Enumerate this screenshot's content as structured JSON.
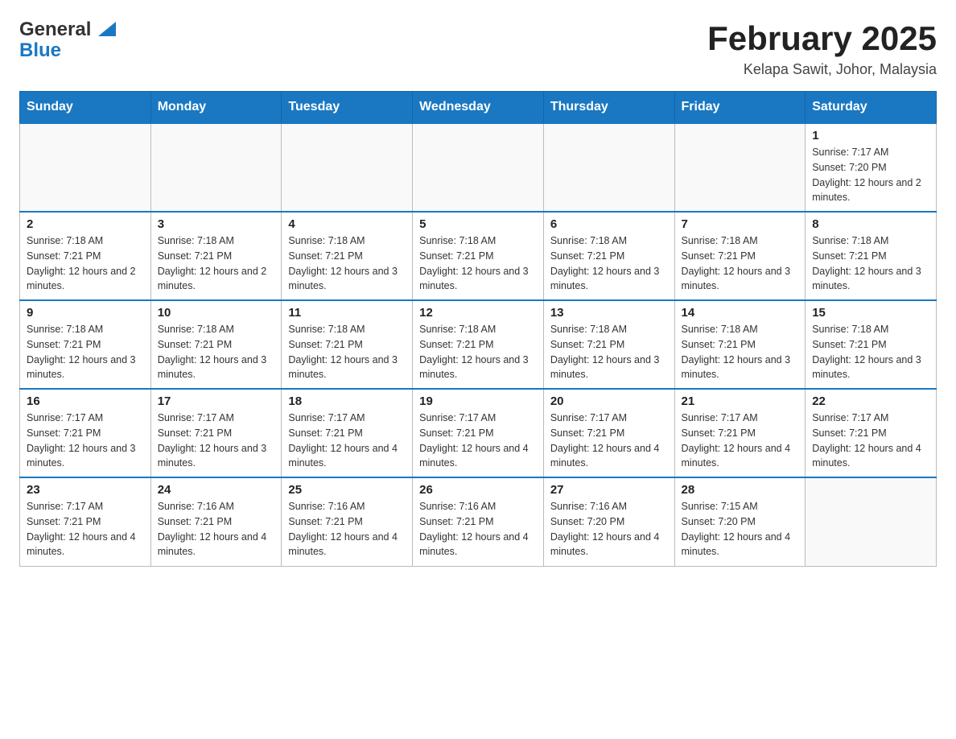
{
  "header": {
    "logo_general": "General",
    "logo_blue": "Blue",
    "calendar_title": "February 2025",
    "calendar_subtitle": "Kelapa Sawit, Johor, Malaysia"
  },
  "weekdays": [
    "Sunday",
    "Monday",
    "Tuesday",
    "Wednesday",
    "Thursday",
    "Friday",
    "Saturday"
  ],
  "weeks": [
    [
      {
        "day": "",
        "sunrise": "",
        "sunset": "",
        "daylight": ""
      },
      {
        "day": "",
        "sunrise": "",
        "sunset": "",
        "daylight": ""
      },
      {
        "day": "",
        "sunrise": "",
        "sunset": "",
        "daylight": ""
      },
      {
        "day": "",
        "sunrise": "",
        "sunset": "",
        "daylight": ""
      },
      {
        "day": "",
        "sunrise": "",
        "sunset": "",
        "daylight": ""
      },
      {
        "day": "",
        "sunrise": "",
        "sunset": "",
        "daylight": ""
      },
      {
        "day": "1",
        "sunrise": "Sunrise: 7:17 AM",
        "sunset": "Sunset: 7:20 PM",
        "daylight": "Daylight: 12 hours and 2 minutes."
      }
    ],
    [
      {
        "day": "2",
        "sunrise": "Sunrise: 7:18 AM",
        "sunset": "Sunset: 7:21 PM",
        "daylight": "Daylight: 12 hours and 2 minutes."
      },
      {
        "day": "3",
        "sunrise": "Sunrise: 7:18 AM",
        "sunset": "Sunset: 7:21 PM",
        "daylight": "Daylight: 12 hours and 2 minutes."
      },
      {
        "day": "4",
        "sunrise": "Sunrise: 7:18 AM",
        "sunset": "Sunset: 7:21 PM",
        "daylight": "Daylight: 12 hours and 3 minutes."
      },
      {
        "day": "5",
        "sunrise": "Sunrise: 7:18 AM",
        "sunset": "Sunset: 7:21 PM",
        "daylight": "Daylight: 12 hours and 3 minutes."
      },
      {
        "day": "6",
        "sunrise": "Sunrise: 7:18 AM",
        "sunset": "Sunset: 7:21 PM",
        "daylight": "Daylight: 12 hours and 3 minutes."
      },
      {
        "day": "7",
        "sunrise": "Sunrise: 7:18 AM",
        "sunset": "Sunset: 7:21 PM",
        "daylight": "Daylight: 12 hours and 3 minutes."
      },
      {
        "day": "8",
        "sunrise": "Sunrise: 7:18 AM",
        "sunset": "Sunset: 7:21 PM",
        "daylight": "Daylight: 12 hours and 3 minutes."
      }
    ],
    [
      {
        "day": "9",
        "sunrise": "Sunrise: 7:18 AM",
        "sunset": "Sunset: 7:21 PM",
        "daylight": "Daylight: 12 hours and 3 minutes."
      },
      {
        "day": "10",
        "sunrise": "Sunrise: 7:18 AM",
        "sunset": "Sunset: 7:21 PM",
        "daylight": "Daylight: 12 hours and 3 minutes."
      },
      {
        "day": "11",
        "sunrise": "Sunrise: 7:18 AM",
        "sunset": "Sunset: 7:21 PM",
        "daylight": "Daylight: 12 hours and 3 minutes."
      },
      {
        "day": "12",
        "sunrise": "Sunrise: 7:18 AM",
        "sunset": "Sunset: 7:21 PM",
        "daylight": "Daylight: 12 hours and 3 minutes."
      },
      {
        "day": "13",
        "sunrise": "Sunrise: 7:18 AM",
        "sunset": "Sunset: 7:21 PM",
        "daylight": "Daylight: 12 hours and 3 minutes."
      },
      {
        "day": "14",
        "sunrise": "Sunrise: 7:18 AM",
        "sunset": "Sunset: 7:21 PM",
        "daylight": "Daylight: 12 hours and 3 minutes."
      },
      {
        "day": "15",
        "sunrise": "Sunrise: 7:18 AM",
        "sunset": "Sunset: 7:21 PM",
        "daylight": "Daylight: 12 hours and 3 minutes."
      }
    ],
    [
      {
        "day": "16",
        "sunrise": "Sunrise: 7:17 AM",
        "sunset": "Sunset: 7:21 PM",
        "daylight": "Daylight: 12 hours and 3 minutes."
      },
      {
        "day": "17",
        "sunrise": "Sunrise: 7:17 AM",
        "sunset": "Sunset: 7:21 PM",
        "daylight": "Daylight: 12 hours and 3 minutes."
      },
      {
        "day": "18",
        "sunrise": "Sunrise: 7:17 AM",
        "sunset": "Sunset: 7:21 PM",
        "daylight": "Daylight: 12 hours and 4 minutes."
      },
      {
        "day": "19",
        "sunrise": "Sunrise: 7:17 AM",
        "sunset": "Sunset: 7:21 PM",
        "daylight": "Daylight: 12 hours and 4 minutes."
      },
      {
        "day": "20",
        "sunrise": "Sunrise: 7:17 AM",
        "sunset": "Sunset: 7:21 PM",
        "daylight": "Daylight: 12 hours and 4 minutes."
      },
      {
        "day": "21",
        "sunrise": "Sunrise: 7:17 AM",
        "sunset": "Sunset: 7:21 PM",
        "daylight": "Daylight: 12 hours and 4 minutes."
      },
      {
        "day": "22",
        "sunrise": "Sunrise: 7:17 AM",
        "sunset": "Sunset: 7:21 PM",
        "daylight": "Daylight: 12 hours and 4 minutes."
      }
    ],
    [
      {
        "day": "23",
        "sunrise": "Sunrise: 7:17 AM",
        "sunset": "Sunset: 7:21 PM",
        "daylight": "Daylight: 12 hours and 4 minutes."
      },
      {
        "day": "24",
        "sunrise": "Sunrise: 7:16 AM",
        "sunset": "Sunset: 7:21 PM",
        "daylight": "Daylight: 12 hours and 4 minutes."
      },
      {
        "day": "25",
        "sunrise": "Sunrise: 7:16 AM",
        "sunset": "Sunset: 7:21 PM",
        "daylight": "Daylight: 12 hours and 4 minutes."
      },
      {
        "day": "26",
        "sunrise": "Sunrise: 7:16 AM",
        "sunset": "Sunset: 7:21 PM",
        "daylight": "Daylight: 12 hours and 4 minutes."
      },
      {
        "day": "27",
        "sunrise": "Sunrise: 7:16 AM",
        "sunset": "Sunset: 7:20 PM",
        "daylight": "Daylight: 12 hours and 4 minutes."
      },
      {
        "day": "28",
        "sunrise": "Sunrise: 7:15 AM",
        "sunset": "Sunset: 7:20 PM",
        "daylight": "Daylight: 12 hours and 4 minutes."
      },
      {
        "day": "",
        "sunrise": "",
        "sunset": "",
        "daylight": ""
      }
    ]
  ]
}
